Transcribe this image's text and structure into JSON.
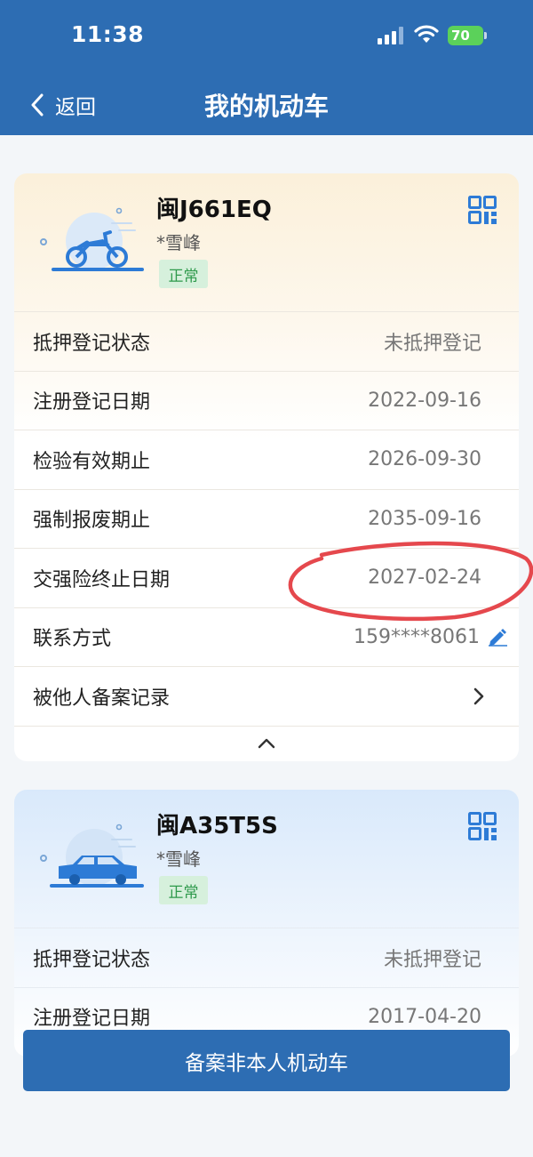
{
  "status_bar": {
    "time": "11:38",
    "battery": "70"
  },
  "nav": {
    "back_label": "返回",
    "title": "我的机动车"
  },
  "vehicles": [
    {
      "type_icon": "motorcycle-icon",
      "plate": "闽J661EQ",
      "owner": "*雪峰",
      "status": "正常",
      "rows": [
        {
          "label": "抵押登记状态",
          "value": "未抵押登记"
        },
        {
          "label": "注册登记日期",
          "value": "2022-09-16"
        },
        {
          "label": "检验有效期止",
          "value": "2026-09-30"
        },
        {
          "label": "强制报废期止",
          "value": "2035-09-16"
        },
        {
          "label": "交强险终止日期",
          "value": "2027-02-24"
        },
        {
          "label": "联系方式",
          "value": "159****8061"
        },
        {
          "label": "被他人备案记录",
          "value": ""
        }
      ]
    },
    {
      "type_icon": "car-icon",
      "plate": "闽A35T5S",
      "owner": "*雪峰",
      "status": "正常",
      "rows": [
        {
          "label": "抵押登记状态",
          "value": "未抵押登记"
        },
        {
          "label": "注册登记日期",
          "value": "2017-04-20"
        }
      ]
    }
  ],
  "bottom_button": {
    "label": "备案非本人机动车"
  },
  "colors": {
    "brand": "#2d6db3",
    "status_green": "#2f9a4c",
    "annotation_red": "#e5484d"
  }
}
